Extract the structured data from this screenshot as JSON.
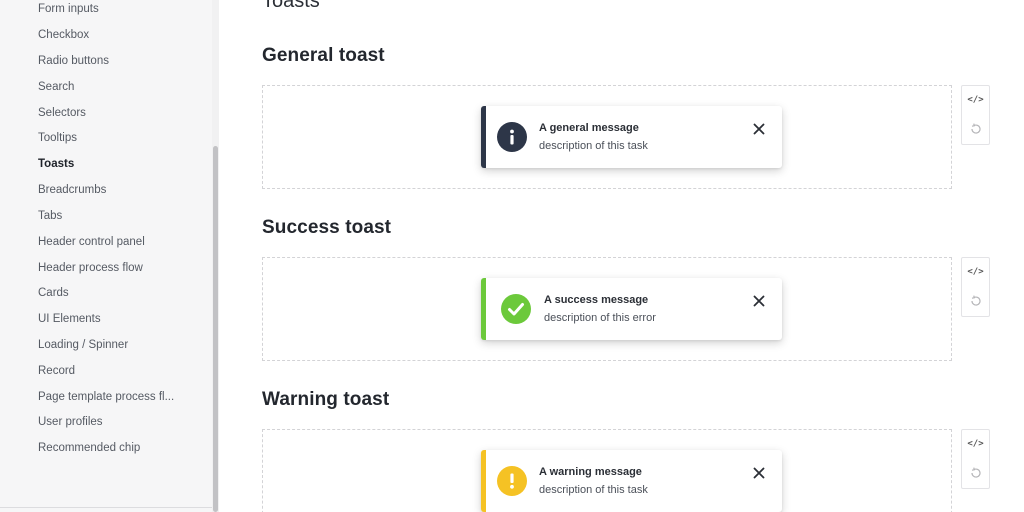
{
  "sidebar": {
    "items": [
      {
        "label": "Form inputs"
      },
      {
        "label": "Checkbox"
      },
      {
        "label": "Radio buttons"
      },
      {
        "label": "Search"
      },
      {
        "label": "Selectors"
      },
      {
        "label": "Tooltips"
      },
      {
        "label": "Toasts",
        "active": true
      },
      {
        "label": "Breadcrumbs"
      },
      {
        "label": "Tabs"
      },
      {
        "label": "Header control panel"
      },
      {
        "label": "Header process flow"
      },
      {
        "label": "Cards"
      },
      {
        "label": "UI Elements"
      },
      {
        "label": "Loading / Spinner"
      },
      {
        "label": "Record"
      },
      {
        "label": "Page template process fl..."
      },
      {
        "label": "User profiles"
      },
      {
        "label": "Recommended chip"
      }
    ]
  },
  "main": {
    "page_title": "Toasts",
    "sections": [
      {
        "title": "General toast",
        "toast": {
          "title": "A general message",
          "description": "description of this task",
          "accent": "#2d3648",
          "icon": "info-icon"
        }
      },
      {
        "title": "Success toast",
        "toast": {
          "title": "A success message",
          "description": "description of this error",
          "accent": "#6cc93b",
          "icon": "check-icon"
        }
      },
      {
        "title": "Warning toast",
        "toast": {
          "title": "A warning message",
          "description": "description of this task",
          "accent": "#f5c224",
          "icon": "warning-icon"
        }
      }
    ],
    "tools": {
      "code_label": "</>"
    }
  }
}
